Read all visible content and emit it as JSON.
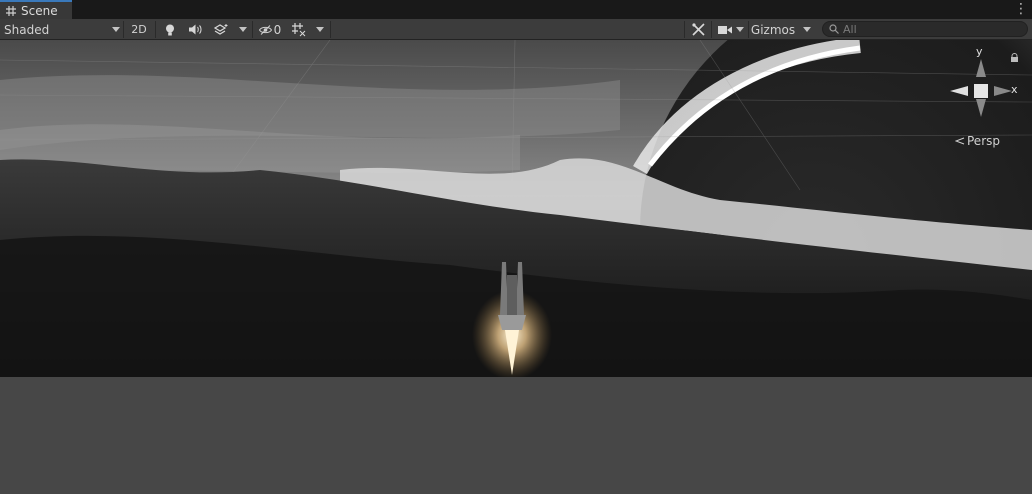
{
  "tab": {
    "label": "Scene",
    "icon": "hash-grid-icon"
  },
  "toolbar": {
    "shading_mode": "Shaded",
    "mode_2d": "2D",
    "hidden_count": "0",
    "gizmos_label": "Gizmos",
    "search_placeholder": "All"
  },
  "gizmo": {
    "y_label": "y",
    "x_label": "x",
    "projection_label": "Persp",
    "lock_icon": "lock-icon"
  },
  "colors": {
    "tab_accent": "#3a79bb",
    "toolbar_bg": "#3c3c3c",
    "ground": "#474747",
    "engine_glow": "#f0d9b0"
  }
}
